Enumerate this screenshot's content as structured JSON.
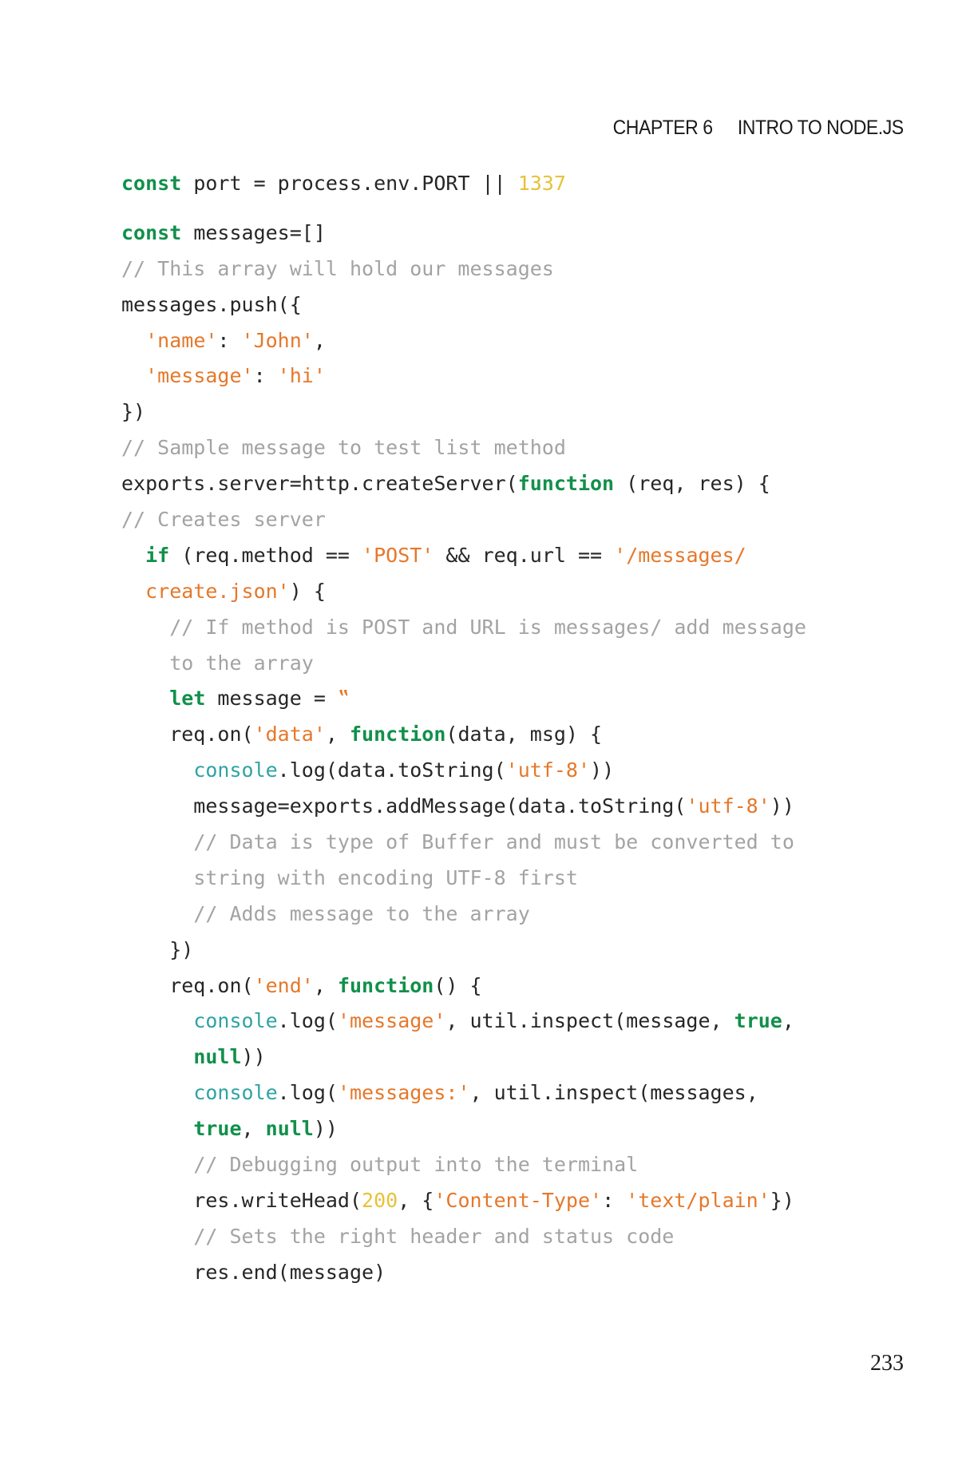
{
  "header": {
    "chapter": "CHAPTER 6",
    "title": "INTRO TO NODE.JS"
  },
  "page_number": "233",
  "colors": {
    "keyword": "#11904a",
    "string": "#e5782a",
    "number": "#e7c23a",
    "comment": "#a3a3a3",
    "builtin": "#2fa3a3",
    "plain": "#262626"
  },
  "code_lines": [
    {
      "gap": true,
      "tokens": [
        {
          "t": "kw",
          "v": "const"
        },
        {
          "t": "pln",
          "v": " port = process.env.PORT || "
        },
        {
          "t": "num",
          "v": "1337"
        }
      ]
    },
    {
      "tokens": [
        {
          "t": "kw",
          "v": "const"
        },
        {
          "t": "pln",
          "v": " messages=[]"
        }
      ]
    },
    {
      "tokens": [
        {
          "t": "cmt",
          "v": "// This array will hold our messages"
        }
      ]
    },
    {
      "tokens": [
        {
          "t": "pln",
          "v": "messages.push({"
        }
      ]
    },
    {
      "tokens": [
        {
          "t": "pln",
          "v": "  "
        },
        {
          "t": "str",
          "v": "'name'"
        },
        {
          "t": "pln",
          "v": ": "
        },
        {
          "t": "str",
          "v": "'John'"
        },
        {
          "t": "pln",
          "v": ","
        }
      ]
    },
    {
      "tokens": [
        {
          "t": "pln",
          "v": "  "
        },
        {
          "t": "str",
          "v": "'message'"
        },
        {
          "t": "pln",
          "v": ": "
        },
        {
          "t": "str",
          "v": "'hi'"
        }
      ]
    },
    {
      "tokens": [
        {
          "t": "pln",
          "v": "})"
        }
      ]
    },
    {
      "tokens": [
        {
          "t": "cmt",
          "v": "// Sample message to test list method"
        }
      ]
    },
    {
      "tokens": [
        {
          "t": "pln",
          "v": "exports.server=http.createServer("
        },
        {
          "t": "kw",
          "v": "function"
        },
        {
          "t": "pln",
          "v": " (req, res) {"
        }
      ]
    },
    {
      "tokens": [
        {
          "t": "cmt",
          "v": "// Creates server"
        }
      ]
    },
    {
      "tokens": [
        {
          "t": "pln",
          "v": "  "
        },
        {
          "t": "kw",
          "v": "if"
        },
        {
          "t": "pln",
          "v": " (req.method == "
        },
        {
          "t": "str",
          "v": "'POST'"
        },
        {
          "t": "pln",
          "v": " && req.url == "
        },
        {
          "t": "str",
          "v": "'/messages/"
        }
      ]
    },
    {
      "tokens": [
        {
          "t": "pln",
          "v": "  "
        },
        {
          "t": "str",
          "v": "create.json'"
        },
        {
          "t": "pln",
          "v": ") {"
        }
      ]
    },
    {
      "tokens": [
        {
          "t": "pln",
          "v": "    "
        },
        {
          "t": "cmt",
          "v": "// If method is POST and URL is messages/ add message"
        }
      ]
    },
    {
      "tokens": [
        {
          "t": "pln",
          "v": "    "
        },
        {
          "t": "cmt",
          "v": "to the array"
        }
      ]
    },
    {
      "tokens": [
        {
          "t": "pln",
          "v": "    "
        },
        {
          "t": "kw",
          "v": "let"
        },
        {
          "t": "pln",
          "v": " message = "
        },
        {
          "t": "str",
          "v": "‟"
        }
      ]
    },
    {
      "tokens": [
        {
          "t": "pln",
          "v": "    req.on("
        },
        {
          "t": "str",
          "v": "'data'"
        },
        {
          "t": "pln",
          "v": ", "
        },
        {
          "t": "kw",
          "v": "function"
        },
        {
          "t": "pln",
          "v": "(data, msg) {"
        }
      ]
    },
    {
      "tokens": [
        {
          "t": "pln",
          "v": "      "
        },
        {
          "t": "fn",
          "v": "console"
        },
        {
          "t": "pln",
          "v": ".log(data.toString("
        },
        {
          "t": "str",
          "v": "'utf-8'"
        },
        {
          "t": "pln",
          "v": "))"
        }
      ]
    },
    {
      "tokens": [
        {
          "t": "pln",
          "v": "      message=exports.addMessage(data.toString("
        },
        {
          "t": "str",
          "v": "'utf-8'"
        },
        {
          "t": "pln",
          "v": "))"
        }
      ]
    },
    {
      "tokens": [
        {
          "t": "pln",
          "v": "      "
        },
        {
          "t": "cmt",
          "v": "// Data is type of Buffer and must be converted to"
        }
      ]
    },
    {
      "tokens": [
        {
          "t": "pln",
          "v": "      "
        },
        {
          "t": "cmt",
          "v": "string with encoding UTF-8 first"
        }
      ]
    },
    {
      "tokens": [
        {
          "t": "pln",
          "v": "      "
        },
        {
          "t": "cmt",
          "v": "// Adds message to the array"
        }
      ]
    },
    {
      "tokens": [
        {
          "t": "pln",
          "v": "    })"
        }
      ]
    },
    {
      "tokens": [
        {
          "t": "pln",
          "v": "    req.on("
        },
        {
          "t": "str",
          "v": "'end'"
        },
        {
          "t": "pln",
          "v": ", "
        },
        {
          "t": "kw",
          "v": "function"
        },
        {
          "t": "pln",
          "v": "() {"
        }
      ]
    },
    {
      "tokens": [
        {
          "t": "pln",
          "v": "      "
        },
        {
          "t": "fn",
          "v": "console"
        },
        {
          "t": "pln",
          "v": ".log("
        },
        {
          "t": "str",
          "v": "'message'"
        },
        {
          "t": "pln",
          "v": ", util.inspect(message, "
        },
        {
          "t": "kw",
          "v": "true"
        },
        {
          "t": "pln",
          "v": ","
        }
      ]
    },
    {
      "tokens": [
        {
          "t": "pln",
          "v": "      "
        },
        {
          "t": "kw",
          "v": "null"
        },
        {
          "t": "pln",
          "v": "))"
        }
      ]
    },
    {
      "tokens": [
        {
          "t": "pln",
          "v": "      "
        },
        {
          "t": "fn",
          "v": "console"
        },
        {
          "t": "pln",
          "v": ".log("
        },
        {
          "t": "str",
          "v": "'messages:'"
        },
        {
          "t": "pln",
          "v": ", util.inspect(messages,"
        }
      ]
    },
    {
      "tokens": [
        {
          "t": "pln",
          "v": "      "
        },
        {
          "t": "kw",
          "v": "true"
        },
        {
          "t": "pln",
          "v": ", "
        },
        {
          "t": "kw",
          "v": "null"
        },
        {
          "t": "pln",
          "v": "))"
        }
      ]
    },
    {
      "tokens": [
        {
          "t": "pln",
          "v": "      "
        },
        {
          "t": "cmt",
          "v": "// Debugging output into the terminal"
        }
      ]
    },
    {
      "tokens": [
        {
          "t": "pln",
          "v": "      res.writeHead("
        },
        {
          "t": "num",
          "v": "200"
        },
        {
          "t": "pln",
          "v": ", {"
        },
        {
          "t": "str",
          "v": "'Content-Type'"
        },
        {
          "t": "pln",
          "v": ": "
        },
        {
          "t": "str",
          "v": "'text/plain'"
        },
        {
          "t": "pln",
          "v": "})"
        }
      ]
    },
    {
      "tokens": [
        {
          "t": "pln",
          "v": "      "
        },
        {
          "t": "cmt",
          "v": "// Sets the right header and status code"
        }
      ]
    },
    {
      "tokens": [
        {
          "t": "pln",
          "v": "      res.end(message)"
        }
      ]
    }
  ]
}
